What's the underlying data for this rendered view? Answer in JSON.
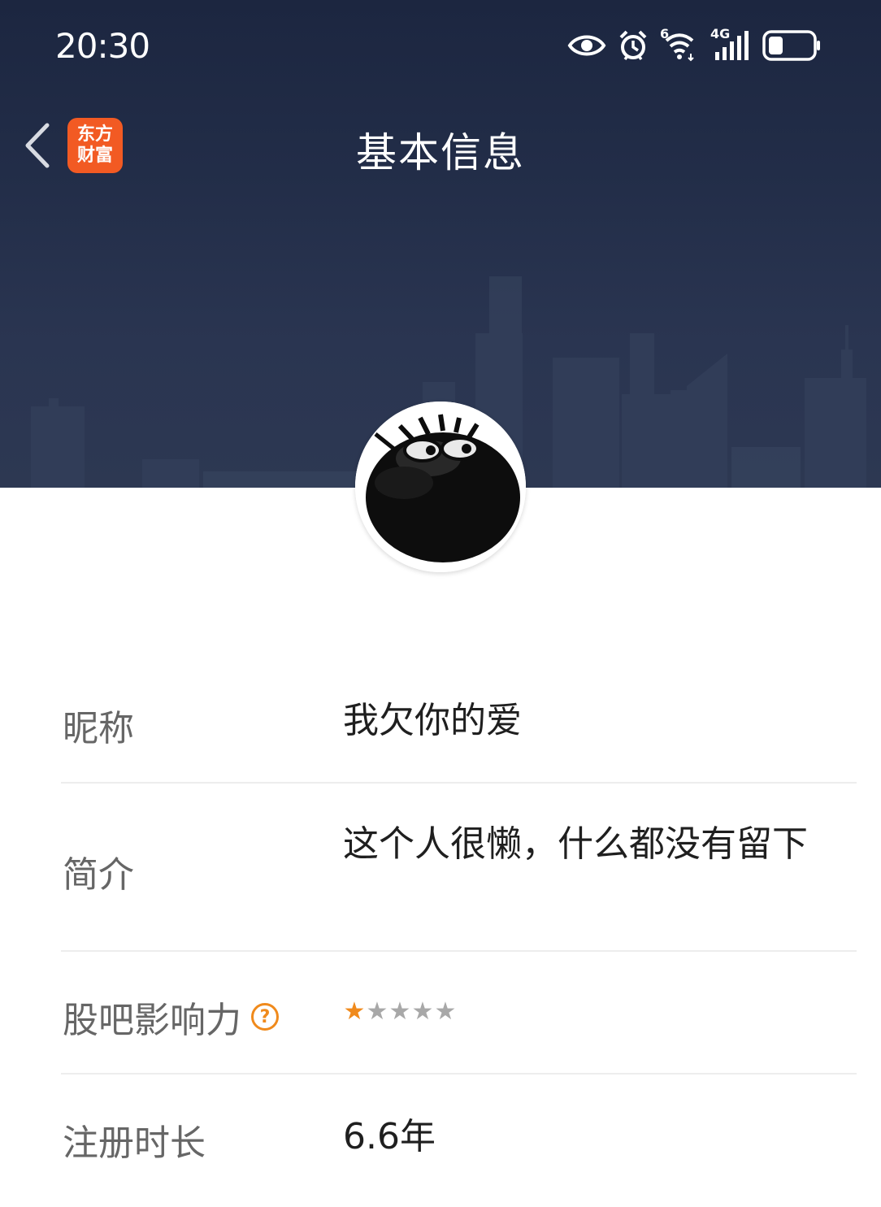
{
  "status_bar": {
    "time": "20:30",
    "icons": [
      "eye-icon",
      "alarm-icon",
      "wifi-6-icon",
      "signal-4g-icon",
      "battery-icon"
    ],
    "wifi_badge": "6",
    "network_badge": "4G"
  },
  "nav": {
    "title": "基本信息",
    "back_icon": "chevron-left-icon",
    "app_logo": {
      "line1": "东方",
      "line2": "财富",
      "color": "#f25a23"
    }
  },
  "profile": {
    "avatar_icon": "grumpy-face-avatar"
  },
  "info": {
    "nickname": {
      "label": "昵称",
      "value": "我欠你的爱"
    },
    "bio": {
      "label": "简介",
      "value": "这个人很懒，什么都没有留下"
    },
    "influence": {
      "label": "股吧影响力",
      "help_icon": "question-circle-icon",
      "help_glyph": "?",
      "rating": 1,
      "max_rating": 5,
      "filled_color": "#f08a1c",
      "empty_color": "#a8a8a8"
    },
    "registration": {
      "label": "注册时长",
      "value": "6.6年"
    }
  }
}
